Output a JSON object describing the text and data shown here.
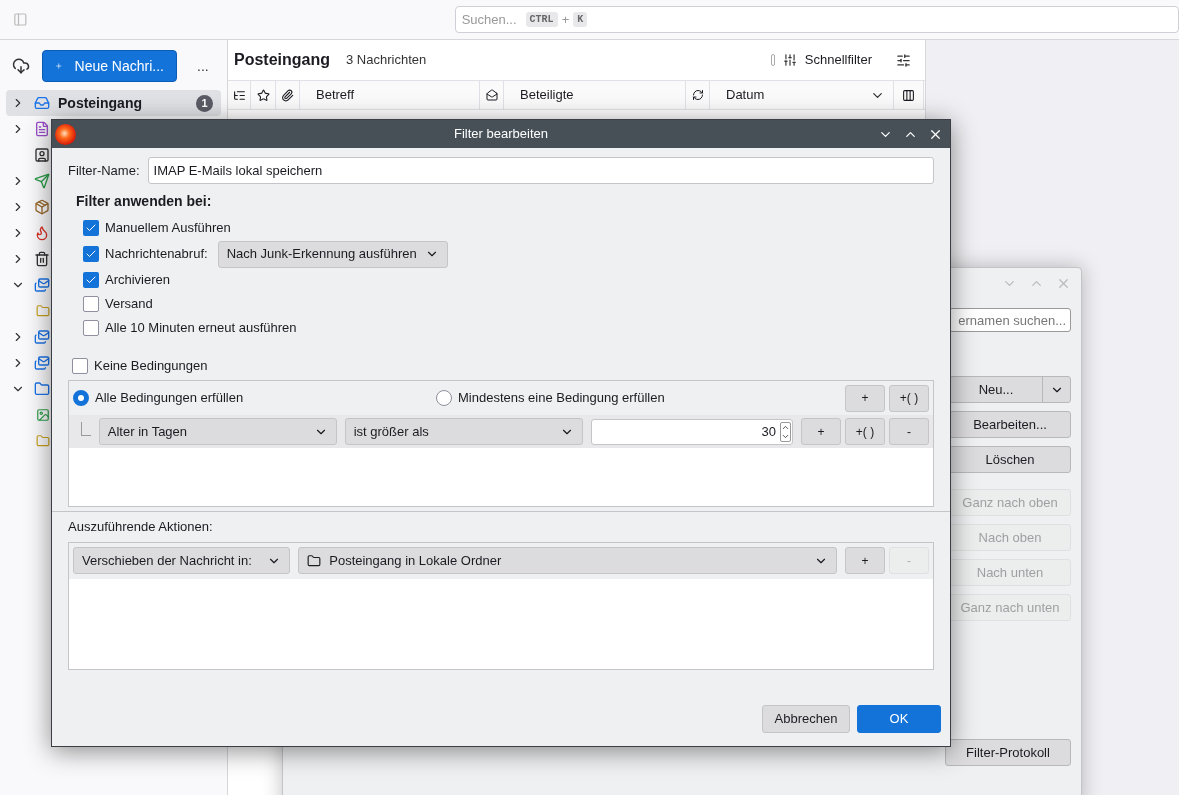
{
  "toolbar": {
    "search": {
      "placeholder": "Suchen...",
      "keys": [
        "CTRL",
        "K"
      ],
      "joiner": "+"
    }
  },
  "sidebar": {
    "new_message": "Neue Nachri...",
    "more": "...",
    "folders": [
      {
        "label": "Posteingang",
        "count": "1",
        "selected": true,
        "expanded": false
      },
      {
        "selected": false,
        "expanded": false
      },
      {
        "selected": false
      },
      {
        "selected": false,
        "expanded": false
      },
      {
        "selected": false,
        "expanded": false
      },
      {
        "selected": false,
        "expanded": false
      },
      {
        "selected": false,
        "expanded": false
      },
      {
        "selected": false,
        "expanded": true,
        "children": [
          {
            "selected": false
          }
        ]
      },
      {
        "selected": false,
        "expanded": false
      },
      {
        "selected": false,
        "expanded": false
      },
      {
        "selected": false,
        "expanded": true,
        "children": [
          {
            "selected": false
          },
          {
            "selected": false
          }
        ]
      }
    ]
  },
  "message_list": {
    "title": "Posteingang",
    "count": "3 Nachrichten",
    "quick_filter": "Schnellfilter",
    "columns": [
      {
        "label": "Betreff",
        "sorted": false
      },
      {
        "label": "Beteiligte",
        "sorted": false
      },
      {
        "label": "Datum",
        "sorted": true
      }
    ]
  },
  "filter_list_window": {
    "search": {
      "placeholder": "ernamen suchen..."
    },
    "buttons": [
      {
        "label": "Neu...",
        "kind": "split",
        "disabled": false
      },
      {
        "label": "Bearbeiten...",
        "kind": "plain",
        "disabled": false
      },
      {
        "label": "Löschen",
        "kind": "plain",
        "disabled": false
      },
      {
        "label": "Ganz nach oben",
        "kind": "plain",
        "disabled": true
      },
      {
        "label": "Nach oben",
        "kind": "plain",
        "disabled": true
      },
      {
        "label": "Nach unten",
        "kind": "plain",
        "disabled": true
      },
      {
        "label": "Ganz nach unten",
        "kind": "plain",
        "disabled": true
      }
    ],
    "log_button": "Filter-Protokoll"
  },
  "dialog": {
    "title": "Filter bearbeiten",
    "name_label": "Filter-Name:",
    "name_value": "IMAP E-Mails lokal speichern",
    "apply_title": "Filter anwenden bei:",
    "apply_options": [
      {
        "label": "Manuellem Ausführen",
        "checked": true
      },
      {
        "label": "Nachrichtenabruf:",
        "checked": true,
        "dropdown": "Nach Junk-Erkennung ausführen"
      },
      {
        "label": "Archivieren",
        "checked": true
      },
      {
        "label": "Versand",
        "checked": false
      },
      {
        "label": "Alle 10 Minuten erneut ausführen",
        "checked": false
      }
    ],
    "no_conditions": {
      "label": "Keine Bedingungen",
      "checked": false
    },
    "match": [
      {
        "label": "Alle Bedingungen erfüllen",
        "selected": true
      },
      {
        "label": "Mindestens eine Bedingung erfüllen",
        "selected": false
      }
    ],
    "group_buttons": [
      "+",
      "+( )"
    ],
    "rules": [
      {
        "field": "Alter in Tagen",
        "operator": "ist größer als",
        "value": "30",
        "buttons": [
          "+",
          "+( )",
          "-"
        ]
      }
    ],
    "actions_label": "Auszuführende Aktionen:",
    "actions": [
      {
        "action": "Verschieben der Nachricht in:",
        "target": "Posteingang in Lokale Ordner",
        "buttons": [
          {
            "label": "+",
            "disabled": false
          },
          {
            "label": "-",
            "disabled": true
          }
        ]
      }
    ],
    "footer": [
      {
        "label": "Abbrechen",
        "kind": "secondary"
      },
      {
        "label": "OK",
        "kind": "primary"
      }
    ]
  }
}
